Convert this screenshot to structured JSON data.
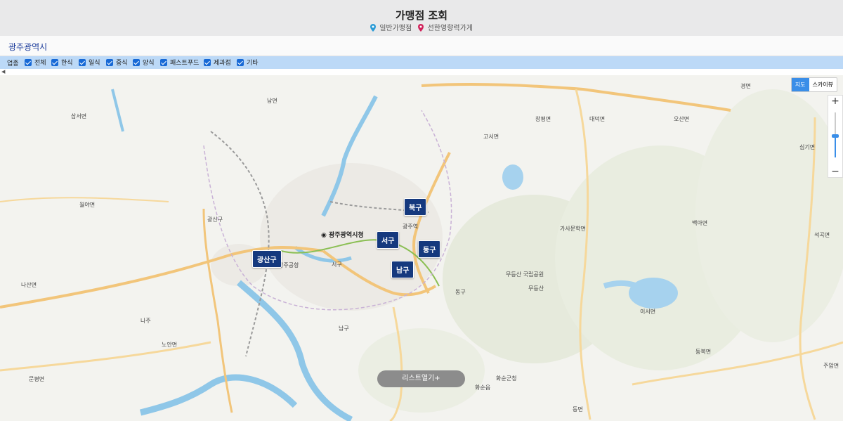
{
  "header": {
    "title": "가맹점 조회",
    "legend": [
      {
        "label": "일반가맹점",
        "color": "#2a9bd6",
        "icon": "map-pin-icon"
      },
      {
        "label": "선한영향력가게",
        "color": "#d0225a",
        "icon": "map-pin-icon"
      }
    ]
  },
  "city": "광주광역시",
  "filter": {
    "label": "업종",
    "options": [
      {
        "label": "전체",
        "checked": true
      },
      {
        "label": "한식",
        "checked": true
      },
      {
        "label": "일식",
        "checked": true
      },
      {
        "label": "중식",
        "checked": true
      },
      {
        "label": "양식",
        "checked": true
      },
      {
        "label": "패스트푸드",
        "checked": true
      },
      {
        "label": "제과점",
        "checked": true
      },
      {
        "label": "기타",
        "checked": true
      }
    ]
  },
  "map": {
    "type_buttons": [
      "지도",
      "스카이뷰"
    ],
    "active_type": "지도",
    "zoom_in": "+",
    "zoom_out": "−",
    "districts": [
      "북구",
      "서구",
      "동구",
      "남구",
      "광산구"
    ],
    "city_hall": "광주광역시청",
    "place_labels": [
      "삼서면",
      "월야면",
      "광신구",
      "나산면",
      "나주",
      "노안면",
      "문평면",
      "남면",
      "창평면",
      "고서면",
      "대덕면",
      "오산면",
      "심기면",
      "가사문학면",
      "백아면",
      "석곡면",
      "이서면",
      "동복면",
      "주암면",
      "화순군청",
      "화순읍",
      "동면",
      "남구",
      "서구",
      "동구",
      "무등산 국립공원",
      "무등산",
      "광주공항",
      "광주역",
      "경면"
    ],
    "list_button": "리스트열기+"
  }
}
